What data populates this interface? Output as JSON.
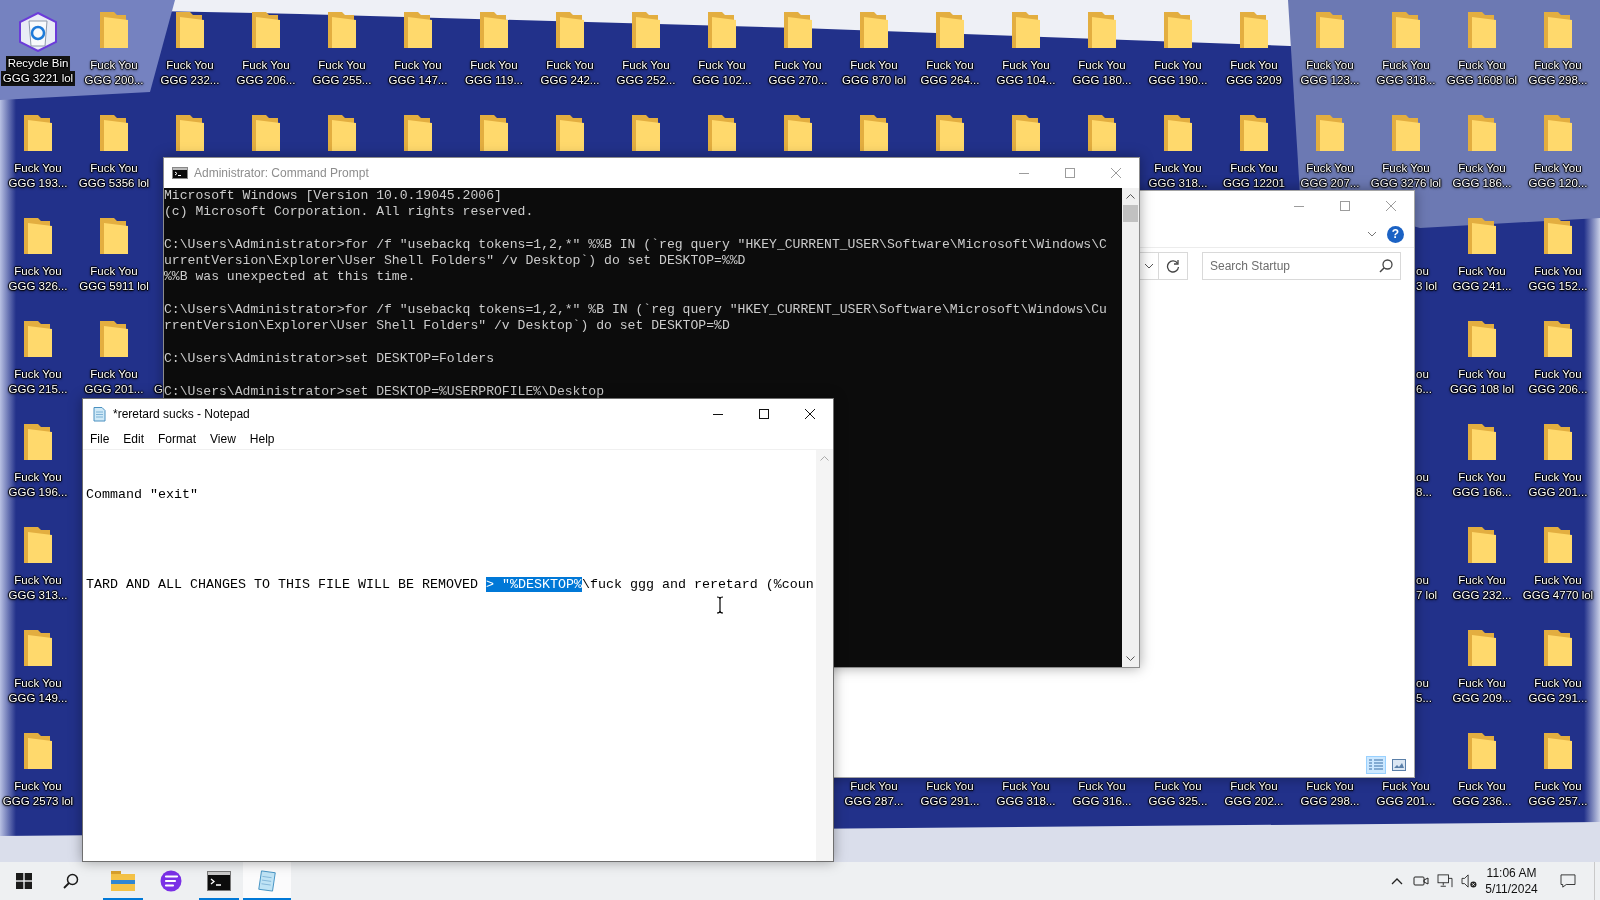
{
  "desktop": {
    "rows": [
      {
        "cells": [
          {
            "kind": "recycle_bin",
            "label": "Recycle Bin",
            "under_label": "GGG 3221 lol"
          },
          {
            "kind": "folder",
            "label": "Fuck You GGG 200..."
          },
          {
            "kind": "folder",
            "label": "Fuck You GGG 232..."
          },
          {
            "kind": "folder",
            "label": "Fuck You GGG 206..."
          },
          {
            "kind": "folder",
            "label": "Fuck You GGG 255..."
          },
          {
            "kind": "folder",
            "label": "Fuck You GGG 147..."
          },
          {
            "kind": "folder",
            "label": "Fuck You GGG 119..."
          },
          {
            "kind": "folder",
            "label": "Fuck You GGG 242..."
          },
          {
            "kind": "folder",
            "label": "Fuck You GGG 252..."
          },
          {
            "kind": "folder",
            "label": "Fuck You GGG 102..."
          },
          {
            "kind": "folder",
            "label": "Fuck You GGG 270..."
          },
          {
            "kind": "folder",
            "label": "Fuck You GGG 870 lol"
          },
          {
            "kind": "folder",
            "label": "Fuck You GGG 264..."
          },
          {
            "kind": "folder",
            "label": "Fuck You GGG 104..."
          },
          {
            "kind": "folder",
            "label": "Fuck You GGG 180..."
          },
          {
            "kind": "folder",
            "label": "Fuck You GGG 190..."
          },
          {
            "kind": "folder",
            "label": "Fuck You GGG 3209"
          },
          {
            "kind": "folder",
            "label": "Fuck You GGG 123..."
          },
          {
            "kind": "folder",
            "label": "Fuck You GGG 318..."
          },
          {
            "kind": "folder",
            "label": "Fuck You GGG 1608 lol"
          },
          {
            "kind": "folder",
            "label": "Fuck You GGG 298..."
          }
        ]
      },
      {
        "cells": [
          {
            "kind": "folder",
            "label": "Fuck You GGG 193..."
          },
          {
            "kind": "folder",
            "label": "Fuck You GGG 5356 lol"
          },
          {
            "kind": "folder_icon"
          },
          {
            "kind": "folder_icon"
          },
          {
            "kind": "folder_icon"
          },
          {
            "kind": "folder_icon"
          },
          {
            "kind": "folder_icon"
          },
          {
            "kind": "folder_icon"
          },
          {
            "kind": "folder_icon"
          },
          {
            "kind": "folder_icon"
          },
          {
            "kind": "folder_icon"
          },
          {
            "kind": "folder_icon"
          },
          {
            "kind": "folder_icon"
          },
          {
            "kind": "folder_icon"
          },
          {
            "kind": "folder_icon"
          },
          {
            "kind": "folder",
            "label": "Fuck You GGG 318..."
          },
          {
            "kind": "folder",
            "label": "Fuck You GGG 12201"
          },
          {
            "kind": "folder",
            "label": "Fuck You GGG 207..."
          },
          {
            "kind": "folder",
            "label": "Fuck You GGG 3276 lol"
          },
          {
            "kind": "folder",
            "label": "Fuck You GGG 186..."
          },
          {
            "kind": "folder",
            "label": "Fuck You GGG 120..."
          }
        ]
      },
      {
        "cells": [
          {
            "kind": "folder",
            "label": "Fuck You GGG 326..."
          },
          {
            "kind": "folder",
            "label": "Fuck You GGG 5911 lol"
          },
          {
            "kind": "covered"
          },
          {
            "kind": "covered"
          },
          {
            "kind": "covered"
          },
          {
            "kind": "covered"
          },
          {
            "kind": "covered"
          },
          {
            "kind": "covered"
          },
          {
            "kind": "covered"
          },
          {
            "kind": "covered"
          },
          {
            "kind": "covered"
          },
          {
            "kind": "covered"
          },
          {
            "kind": "covered"
          },
          {
            "kind": "covered"
          },
          {
            "kind": "covered"
          },
          {
            "kind": "covered"
          },
          {
            "kind": "covered"
          },
          {
            "kind": "covered"
          },
          {
            "kind": "tail",
            "lines": [
              "ou",
              "3 lol"
            ]
          },
          {
            "kind": "folder",
            "label": "Fuck You GGG 241..."
          },
          {
            "kind": "folder",
            "label": "Fuck You GGG 152..."
          }
        ]
      },
      {
        "cells": [
          {
            "kind": "folder",
            "label": "Fuck You GGG 215..."
          },
          {
            "kind": "folder",
            "label": "Fuck You GGG 201..."
          },
          {
            "kind": "head",
            "label": "G"
          },
          {
            "kind": "covered"
          },
          {
            "kind": "covered"
          },
          {
            "kind": "covered"
          },
          {
            "kind": "covered"
          },
          {
            "kind": "covered"
          },
          {
            "kind": "covered"
          },
          {
            "kind": "covered"
          },
          {
            "kind": "covered"
          },
          {
            "kind": "covered"
          },
          {
            "kind": "covered"
          },
          {
            "kind": "covered"
          },
          {
            "kind": "covered"
          },
          {
            "kind": "covered"
          },
          {
            "kind": "covered"
          },
          {
            "kind": "covered"
          },
          {
            "kind": "tail",
            "lines": [
              "ou",
              "6..."
            ]
          },
          {
            "kind": "folder",
            "label": "Fuck You GGG 108 lol"
          },
          {
            "kind": "folder",
            "label": "Fuck You GGG 206..."
          }
        ]
      },
      {
        "cells": [
          {
            "kind": "folder",
            "label": "Fuck You GGG 196..."
          },
          {
            "kind": "covered"
          },
          {
            "kind": "covered"
          },
          {
            "kind": "covered"
          },
          {
            "kind": "covered"
          },
          {
            "kind": "covered"
          },
          {
            "kind": "covered"
          },
          {
            "kind": "covered"
          },
          {
            "kind": "covered"
          },
          {
            "kind": "covered"
          },
          {
            "kind": "covered"
          },
          {
            "kind": "covered"
          },
          {
            "kind": "covered"
          },
          {
            "kind": "covered"
          },
          {
            "kind": "covered"
          },
          {
            "kind": "covered"
          },
          {
            "kind": "covered"
          },
          {
            "kind": "covered"
          },
          {
            "kind": "tail",
            "lines": [
              "ou",
              "8..."
            ]
          },
          {
            "kind": "folder",
            "label": "Fuck You GGG 166..."
          },
          {
            "kind": "folder",
            "label": "Fuck You GGG 201..."
          }
        ]
      },
      {
        "cells": [
          {
            "kind": "folder",
            "label": "Fuck You GGG 313..."
          },
          {
            "kind": "covered"
          },
          {
            "kind": "covered"
          },
          {
            "kind": "covered"
          },
          {
            "kind": "covered"
          },
          {
            "kind": "covered"
          },
          {
            "kind": "covered"
          },
          {
            "kind": "covered"
          },
          {
            "kind": "covered"
          },
          {
            "kind": "covered"
          },
          {
            "kind": "covered"
          },
          {
            "kind": "covered"
          },
          {
            "kind": "covered"
          },
          {
            "kind": "covered"
          },
          {
            "kind": "covered"
          },
          {
            "kind": "covered"
          },
          {
            "kind": "covered"
          },
          {
            "kind": "covered"
          },
          {
            "kind": "tail",
            "lines": [
              "ou",
              "7 lol"
            ]
          },
          {
            "kind": "folder",
            "label": "Fuck You GGG 232..."
          },
          {
            "kind": "folder",
            "label": "Fuck You GGG 4770 lol"
          }
        ]
      },
      {
        "cells": [
          {
            "kind": "folder",
            "label": "Fuck You GGG 149..."
          },
          {
            "kind": "covered"
          },
          {
            "kind": "covered"
          },
          {
            "kind": "covered"
          },
          {
            "kind": "covered"
          },
          {
            "kind": "covered"
          },
          {
            "kind": "covered"
          },
          {
            "kind": "covered"
          },
          {
            "kind": "covered"
          },
          {
            "kind": "covered"
          },
          {
            "kind": "covered"
          },
          {
            "kind": "covered"
          },
          {
            "kind": "covered"
          },
          {
            "kind": "covered"
          },
          {
            "kind": "covered"
          },
          {
            "kind": "covered"
          },
          {
            "kind": "covered"
          },
          {
            "kind": "covered"
          },
          {
            "kind": "tail",
            "lines": [
              "ou",
              "5..."
            ]
          },
          {
            "kind": "folder",
            "label": "Fuck You GGG 209..."
          },
          {
            "kind": "folder",
            "label": "Fuck You GGG 291..."
          }
        ]
      },
      {
        "cells": [
          {
            "kind": "folder",
            "label": "Fuck You GGG 2573 lol"
          },
          {
            "kind": "covered"
          },
          {
            "kind": "covered"
          },
          {
            "kind": "covered"
          },
          {
            "kind": "covered"
          },
          {
            "kind": "covered"
          },
          {
            "kind": "covered"
          },
          {
            "kind": "covered"
          },
          {
            "kind": "covered"
          },
          {
            "kind": "covered"
          },
          {
            "kind": "covered"
          },
          {
            "kind": "label",
            "label": "Fuck You GGG 287..."
          },
          {
            "kind": "label",
            "label": "Fuck You GGG 291..."
          },
          {
            "kind": "label",
            "label": "Fuck You GGG 318..."
          },
          {
            "kind": "label",
            "label": "Fuck You GGG 316..."
          },
          {
            "kind": "label",
            "label": "Fuck You GGG 325..."
          },
          {
            "kind": "label",
            "label": "Fuck You GGG 202..."
          },
          {
            "kind": "label",
            "label": "Fuck You GGG 298..."
          },
          {
            "kind": "label",
            "label": "Fuck You GGG 201..."
          },
          {
            "kind": "folder",
            "label": "Fuck You GGG 236..."
          },
          {
            "kind": "folder",
            "label": "Fuck You GGG 257..."
          }
        ]
      }
    ]
  },
  "command_prompt": {
    "title": "Administrator: Command Prompt",
    "active": false,
    "blocks": [
      [
        "Microsoft Windows [Version 10.0.19045.2006]",
        "(c) Microsoft Corporation. All rights reserved."
      ],
      [
        "C:\\Users\\Administrator>for /f \"usebackq tokens=1,2,*\" %%B IN (`reg query \"HKEY_CURRENT_USER\\Software\\Microsoft\\Windows\\C",
        "urrentVersion\\Explorer\\User Shell Folders\" /v Desktop`) do set DESKTOP=%%D",
        "%%B was unexpected at this time."
      ],
      [
        "C:\\Users\\Administrator>for /f \"usebackq tokens=1,2,*\" %B IN (`reg query \"HKEY_CURRENT_USER\\Software\\Microsoft\\Windows\\Cu",
        "rrentVersion\\Explorer\\User Shell Folders\" /v Desktop`) do set DESKTOP=%D"
      ],
      [
        "C:\\Users\\Administrator>set DESKTOP=Folders"
      ],
      [
        "C:\\Users\\Administrator>set DESKTOP=%USERPROFILE%\\Desktop"
      ]
    ]
  },
  "explorer": {
    "active": false,
    "help": "?",
    "search": {
      "placeholder": "Search Startup"
    },
    "view_buttons": [
      {
        "kind": "details",
        "selected": true
      },
      {
        "kind": "large_icons",
        "selected": false
      }
    ]
  },
  "notepad": {
    "title": "*reretard sucks - Notepad",
    "active": true,
    "menu": [
      "File",
      "Edit",
      "Format",
      "View",
      "Help"
    ],
    "lines": [
      {
        "segments": [
          {
            "text": "Command \"exit\"",
            "selected": false
          }
        ]
      },
      {
        "segments": [
          {
            "text": "TARD AND ALL CHANGES TO THIS FILE WILL BE REMOVED ",
            "selected": false
          },
          {
            "text": "> \"%DESKTOP%",
            "selected": true
          },
          {
            "text": "\\fuck ggg and reretard (%coun",
            "selected": false
          }
        ]
      }
    ]
  },
  "taskbar": {
    "apps": [
      {
        "kind": "file_explorer",
        "running": true,
        "active": false
      },
      {
        "kind": "app",
        "running": false,
        "active": false
      },
      {
        "kind": "terminal",
        "running": true,
        "active": false
      },
      {
        "kind": "notepad",
        "running": true,
        "active": true
      }
    ],
    "clock": {
      "time": "11:06 AM",
      "date": "5/11/2024"
    }
  }
}
